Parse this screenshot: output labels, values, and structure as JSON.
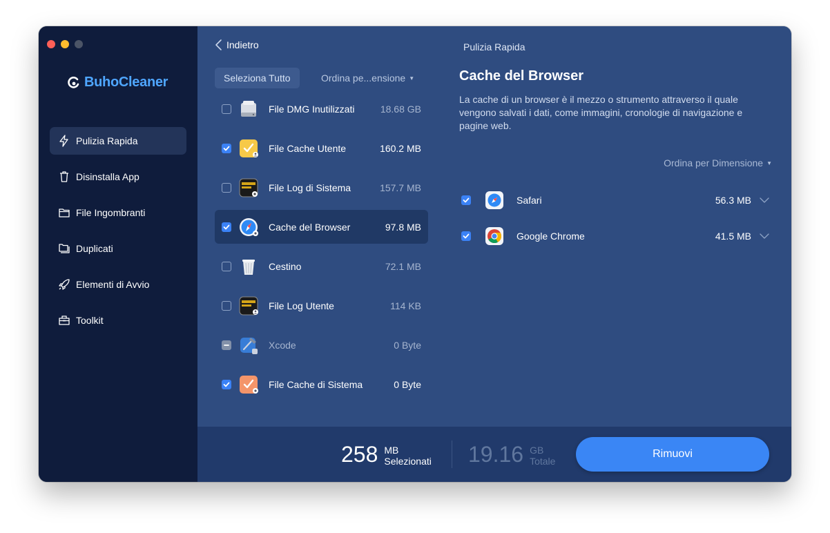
{
  "app": {
    "name": "BuhoCleaner"
  },
  "window": {
    "traffic_colors": [
      "#fe5f57",
      "#febc2e",
      "#4b5466"
    ]
  },
  "sidebar": {
    "items": [
      {
        "label": "Pulizia Rapida",
        "icon": "bolt-icon",
        "active": true
      },
      {
        "label": "Disinstalla App",
        "icon": "trash-icon",
        "active": false
      },
      {
        "label": "File Ingombranti",
        "icon": "folder-icon",
        "active": false
      },
      {
        "label": "Duplicati",
        "icon": "duplicate-folder-icon",
        "active": false
      },
      {
        "label": "Elementi di Avvio",
        "icon": "rocket-icon",
        "active": false
      },
      {
        "label": "Toolkit",
        "icon": "toolbox-icon",
        "active": false
      }
    ]
  },
  "middle": {
    "back_label": "Indietro",
    "select_all": "Seleziona Tutto",
    "sort_label": "Ordina pe...ensione",
    "items": [
      {
        "name": "File DMG Inutilizzati",
        "size": "18.68 GB",
        "state": "unchecked",
        "icon": "disk-icon"
      },
      {
        "name": "File Cache Utente",
        "size": "160.2 MB",
        "state": "checked",
        "icon": "user-cache-icon"
      },
      {
        "name": "File Log di Sistema",
        "size": "157.7 MB",
        "state": "unchecked",
        "icon": "system-log-icon"
      },
      {
        "name": "Cache del Browser",
        "size": "97.8 MB",
        "state": "checked",
        "icon": "browser-cache-icon",
        "active": true
      },
      {
        "name": "Cestino",
        "size": "72.1 MB",
        "state": "unchecked",
        "icon": "bin-icon"
      },
      {
        "name": "File Log Utente",
        "size": "114 KB",
        "state": "unchecked",
        "icon": "user-log-icon"
      },
      {
        "name": "Xcode",
        "size": "0 Byte",
        "state": "partial",
        "icon": "xcode-icon"
      },
      {
        "name": "File Cache di Sistema",
        "size": "0 Byte",
        "state": "checked",
        "icon": "system-cache-icon"
      }
    ]
  },
  "right": {
    "header_title": "Pulizia Rapida",
    "title": "Cache del Browser",
    "description": "La cache di un browser è il mezzo o strumento attraverso il quale vengono salvati i dati, come immagini, cronologie di navigazione e pagine web.",
    "sort_label": "Ordina per Dimensione",
    "browsers": [
      {
        "name": "Safari",
        "size": "56.3 MB",
        "checked": true,
        "icon": "safari-icon"
      },
      {
        "name": "Google Chrome",
        "size": "41.5 MB",
        "checked": true,
        "icon": "chrome-icon"
      }
    ]
  },
  "bottom": {
    "selected_value": "258",
    "selected_unit": "MB",
    "selected_label": "Selezionati",
    "total_value": "19.16",
    "total_unit": "GB",
    "total_label": "Totale",
    "remove_label": "Rimuovi"
  }
}
